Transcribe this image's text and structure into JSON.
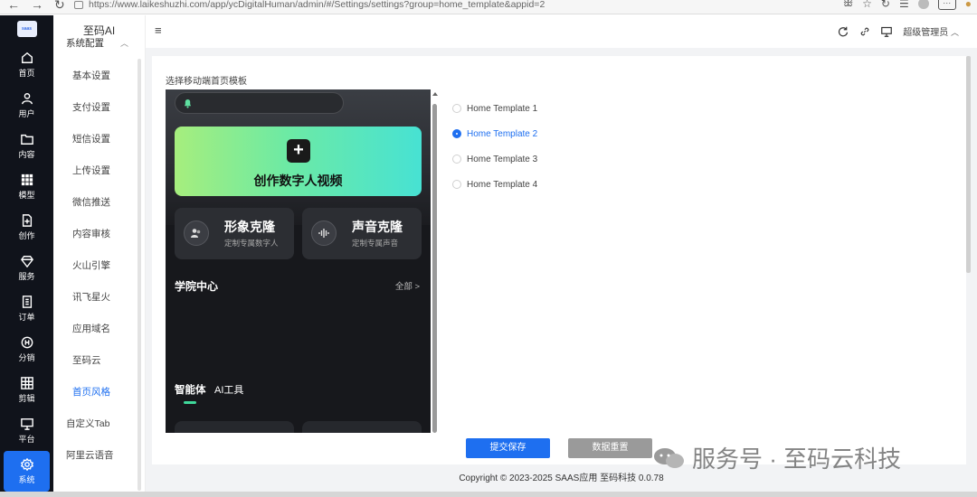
{
  "browser": {
    "url": "https://www.laikeshuzhi.com/app/ycDigitalHuman/admin/#/Settings/settings?group=home_template&appid=2"
  },
  "rail": {
    "logo_text": "saas",
    "items": [
      {
        "label": "首页",
        "icon": "home-icon"
      },
      {
        "label": "用户",
        "icon": "user-icon"
      },
      {
        "label": "内容",
        "icon": "folder-icon"
      },
      {
        "label": "模型",
        "icon": "grid-icon"
      },
      {
        "label": "创作",
        "icon": "file-plus-icon"
      },
      {
        "label": "服务",
        "icon": "diamond-icon"
      },
      {
        "label": "订单",
        "icon": "order-icon"
      },
      {
        "label": "分销",
        "icon": "distribution-icon"
      },
      {
        "label": "剪辑",
        "icon": "clip-icon"
      },
      {
        "label": "平台",
        "icon": "monitor-icon"
      },
      {
        "label": "系统",
        "icon": "gear-icon"
      }
    ]
  },
  "submenu": {
    "brand": "至码AI",
    "group": "系统配置",
    "items": [
      "基本设置",
      "支付设置",
      "短信设置",
      "上传设置",
      "微信推送",
      "内容审核",
      "火山引擎",
      "讯飞星火",
      "应用域名",
      "至码云",
      "首页风格",
      "自定义Tab",
      "阿里云语音"
    ]
  },
  "header": {
    "menu_icon": "≡",
    "user": "超级管理员"
  },
  "main": {
    "section_label": "选择移动端首页模板",
    "templates": [
      "Home Template 1",
      "Home Template 2",
      "Home Template 3",
      "Home Template 4"
    ],
    "selected_template": "Home Template 2",
    "save_label": "提交保存",
    "reset_label": "数据重置"
  },
  "preview": {
    "create_title": "创作数字人视频",
    "tile1_title": "形象克隆",
    "tile1_sub": "定制专属数字人",
    "tile2_title": "声音克隆",
    "tile2_sub": "定制专属声音",
    "section_title": "学院中心",
    "all_link": "全部 >",
    "tab_active": "智能体",
    "tab_other": "AI工具",
    "accent_color": "#3fd89a"
  },
  "footer": {
    "copyright": "Copyright © 2023-2025 SAAS应用  至码科技 0.0.78"
  },
  "watermark": {
    "text": "服务号 · 至码云科技"
  },
  "colors": {
    "primary": "#1e6ff0",
    "rail_bg": "#10131b",
    "reset_btn": "#9a9a9a"
  }
}
